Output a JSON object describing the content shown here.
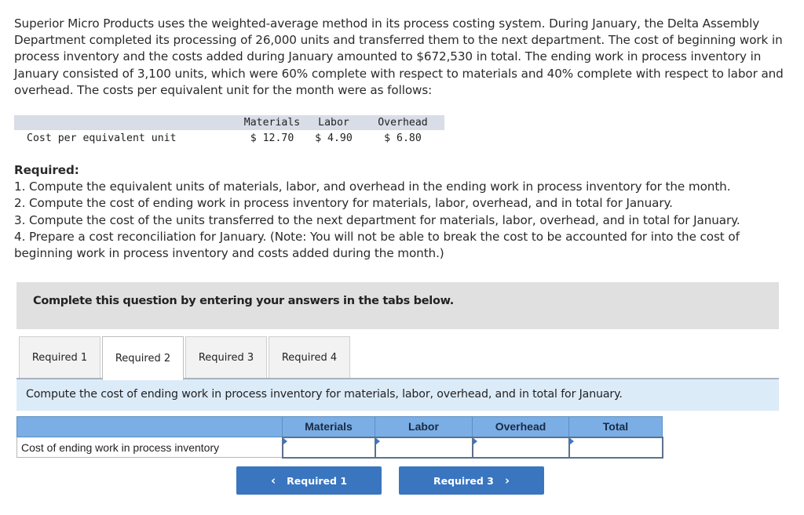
{
  "problem": {
    "intro": "Superior Micro Products uses the weighted-average method in its process costing system. During January, the Delta Assembly Department completed its processing of 26,000 units and transferred them to the next department. The cost of beginning work in process inventory and the costs added during January amounted to $672,530 in total. The ending work in process inventory in January consisted of 3,100 units, which were 60% complete with respect to materials and 40% complete with respect to labor and overhead. The costs per equivalent unit for the month were as follows:",
    "cost_table": {
      "headers": [
        "",
        "Materials",
        "Labor",
        "Overhead"
      ],
      "row_label": "Cost per equivalent unit",
      "values": [
        "$ 12.70",
        "$ 4.90",
        "$ 6.80"
      ]
    },
    "required_title": "Required:",
    "required_items": [
      "1. Compute the equivalent units of materials, labor, and overhead in the ending work in process inventory for the month.",
      "2. Compute the cost of ending work in process inventory for materials, labor, overhead, and in total for January.",
      "3. Compute the cost of the units transferred to the next department for materials, labor, overhead, and in total for January.",
      "4. Prepare a cost reconciliation for January. (Note: You will not be able to break the cost to be accounted for into the cost of beginning work in process inventory and costs added during the month.)"
    ]
  },
  "instruction": "Complete this question by entering your answers in the tabs below.",
  "tabs": [
    {
      "label": "Required 1",
      "active": false
    },
    {
      "label": "Required 2",
      "active": true
    },
    {
      "label": "Required 3",
      "active": false
    },
    {
      "label": "Required 4",
      "active": false
    }
  ],
  "prompt": "Compute the cost of ending work in process inventory for materials, labor, overhead, and in total for January.",
  "answer_table": {
    "headers": [
      "",
      "Materials",
      "Labor",
      "Overhead",
      "Total"
    ],
    "row_label": "Cost of ending work in process inventory",
    "values": [
      "",
      "",
      "",
      ""
    ]
  },
  "nav": {
    "prev_label": "Required 1",
    "next_label": "Required 3",
    "prev_icon": "chevron-left-icon",
    "next_icon": "chevron-right-icon"
  },
  "colors": {
    "header_blue": "#7aaee5",
    "button_blue": "#3a75c0",
    "prompt_bg": "#dcebf8",
    "instruction_bg": "#e0e0e0"
  }
}
